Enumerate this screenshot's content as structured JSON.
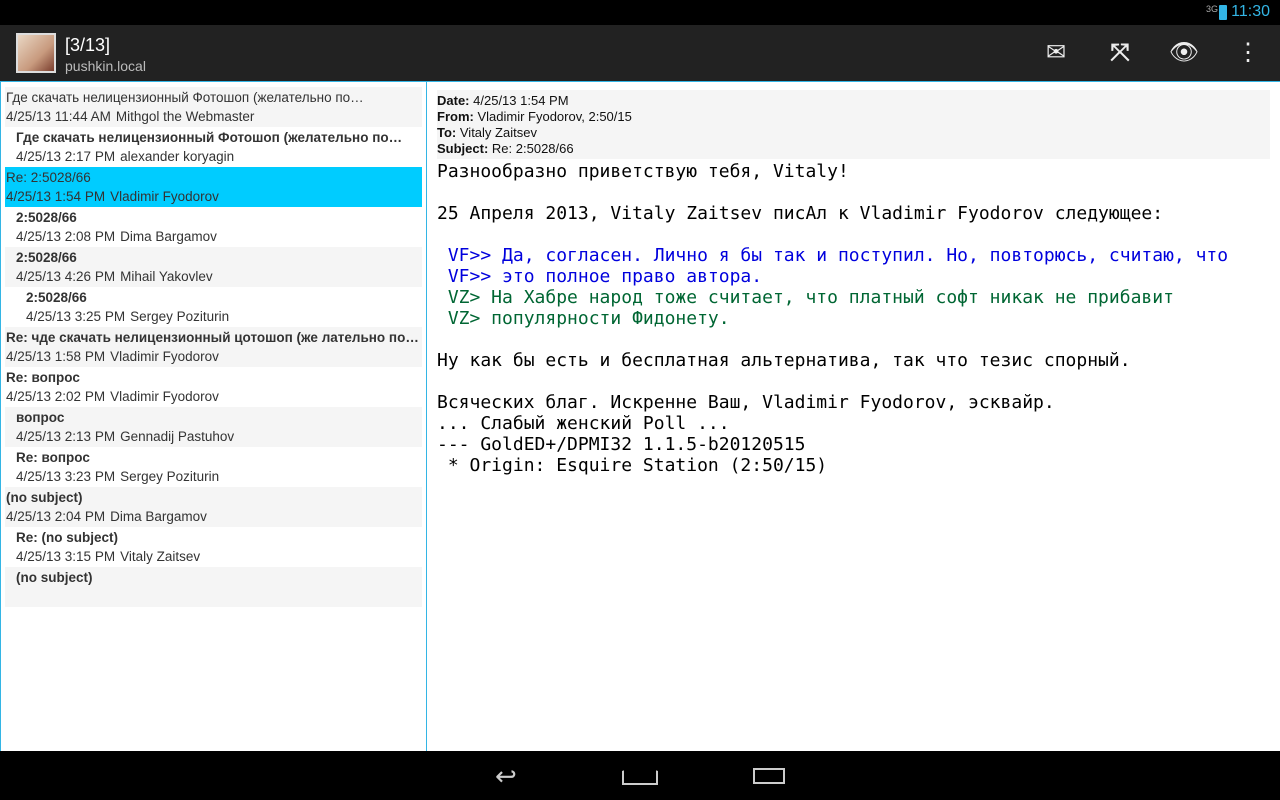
{
  "status": {
    "network": "3G",
    "time": "11:30"
  },
  "actionbar": {
    "title": "[3/13]",
    "subtitle": "pushkin.local",
    "icons": [
      "mail-icon",
      "fullscreen-icon",
      "eye-icon",
      "overflow-menu-icon"
    ]
  },
  "list": [
    {
      "subject": "Где скачать нелицензионный Фотошоп (желательно по…",
      "date": "4/25/13 11:44 AM",
      "author": "Mithgol the Webmaster",
      "indent": 0,
      "read": true
    },
    {
      "subject": "Где скачать нелицензионный Фотошоп (желательно по…",
      "date": "4/25/13 2:17 PM",
      "author": "alexander koryagin",
      "indent": 1
    },
    {
      "subject": "Re: 2:5028/66",
      "date": "4/25/13 1:54 PM",
      "author": "Vladimir Fyodorov",
      "indent": 0,
      "selected": true
    },
    {
      "subject": "2:5028/66",
      "date": "4/25/13 2:08 PM",
      "author": "Dima Bargamov",
      "indent": 1
    },
    {
      "subject": "2:5028/66",
      "date": "4/25/13 4:26 PM",
      "author": "Mihail Yakovlev",
      "indent": 1
    },
    {
      "subject": "2:5028/66",
      "date": "4/25/13 3:25 PM",
      "author": "Sergey Poziturin",
      "indent": 2
    },
    {
      "subject": "Re: чде скачать нелицензионный цотошоп (же лательно по…",
      "date": "4/25/13 1:58 PM",
      "author": "Vladimir Fyodorov",
      "indent": 0
    },
    {
      "subject": "Re: вопрос",
      "date": "4/25/13 2:02 PM",
      "author": "Vladimir Fyodorov",
      "indent": 0
    },
    {
      "subject": "вопрос",
      "date": "4/25/13 2:13 PM",
      "author": "Gennadij Pastuhov",
      "indent": 1
    },
    {
      "subject": "Re: вопрос",
      "date": "4/25/13 3:23 PM",
      "author": "Sergey Pozituri­n",
      "indent": 1
    },
    {
      "subject": "(no subject)",
      "date": "4/25/13 2:04 PM",
      "author": "Dima Bargamov",
      "indent": 0
    },
    {
      "subject": "Re: (no subject)",
      "date": "4/25/13 3:15 PM",
      "author": "Vitaly Zaitsev",
      "indent": 1
    },
    {
      "subject": "(no subject)",
      "date": "",
      "author": "",
      "indent": 1
    }
  ],
  "message": {
    "header": {
      "date_label": "Date:",
      "date": "4/25/13 1:54 PM",
      "from_label": "From:",
      "from": "Vladimir Fyodorov, 2:50/15",
      "to_label": "To:",
      "to": "Vitaly Zaitsev",
      "subject_label": "Subject:",
      "subject": "Re: 2:5028/66"
    },
    "lines": [
      {
        "text": "Разнообразно приветствую тебя, Vitaly!",
        "kind": "normal"
      },
      {
        "text": "",
        "kind": "normal"
      },
      {
        "text": "25 Апреля 2013, Vitaly Zaitsev писАл к Vladimir Fyodorov следующее:",
        "kind": "normal"
      },
      {
        "text": "",
        "kind": "normal"
      },
      {
        "text": " VF>> Да, согласен. Лично я бы так и поступил. Но, повторюсь, считаю, что",
        "kind": "quote1"
      },
      {
        "text": " VF>> это полное право автора.",
        "kind": "quote1"
      },
      {
        "text": " VZ> На Хабре народ тоже считает, что платный софт никак не прибавит",
        "kind": "quote2"
      },
      {
        "text": " VZ> популярности Фидонету.",
        "kind": "quote2"
      },
      {
        "text": "",
        "kind": "normal"
      },
      {
        "text": "Ну как бы есть и бесплатная альтернатива, так что тезис спорный.",
        "kind": "normal"
      },
      {
        "text": "",
        "kind": "normal"
      },
      {
        "text": "Всяческих благ. Искренне Ваш, Vladimir Fyodorov, эсквайр.",
        "kind": "normal"
      },
      {
        "text": "... Слабый женский Poll ...",
        "kind": "normal"
      },
      {
        "text": "--- GoldED+/DPMI32 1.1.5-b20120515",
        "kind": "normal"
      },
      {
        "text": " * Origin: Esquire Station (2:50/15)",
        "kind": "normal"
      }
    ]
  },
  "colors": {
    "accent": "#33b5e5",
    "selected": "#00ccff",
    "quote1": "#0000dd",
    "quote2": "#006633"
  }
}
